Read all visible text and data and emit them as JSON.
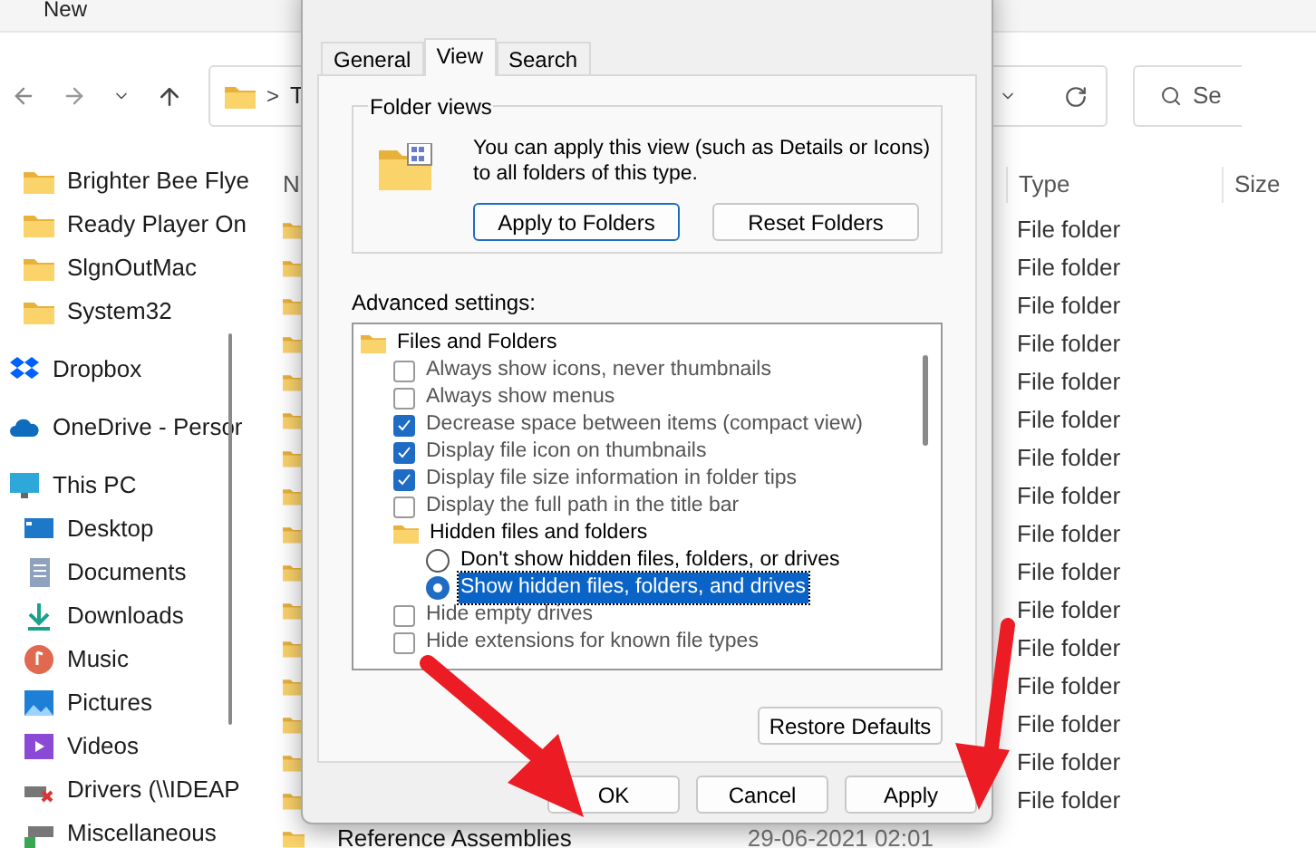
{
  "toolbar": {
    "new_label": "New"
  },
  "address_bar": {
    "separator": ">",
    "path": "T"
  },
  "search": {
    "placeholder": "Se"
  },
  "sidebar": {
    "items": [
      {
        "label": "Brighter Bee Flye",
        "kind": "folder"
      },
      {
        "label": "Ready Player On",
        "kind": "folder"
      },
      {
        "label": "SlgnOutMac",
        "kind": "folder"
      },
      {
        "label": "System32",
        "kind": "folder"
      },
      {
        "label": "Dropbox",
        "kind": "dropbox"
      },
      {
        "label": "OneDrive - Persor",
        "kind": "cloud"
      },
      {
        "label": "This PC",
        "kind": "pc",
        "children": [
          {
            "label": "Desktop",
            "kind": "desktop"
          },
          {
            "label": "Documents",
            "kind": "documents"
          },
          {
            "label": "Downloads",
            "kind": "downloads"
          },
          {
            "label": "Music",
            "kind": "music"
          },
          {
            "label": "Pictures",
            "kind": "pictures"
          },
          {
            "label": "Videos",
            "kind": "videos"
          },
          {
            "label": "Drivers (\\\\IDEAP",
            "kind": "drive"
          },
          {
            "label": "Miscellaneous",
            "kind": "netdrive"
          }
        ]
      }
    ]
  },
  "file_list": {
    "columns": [
      "N",
      "Type",
      "Size"
    ],
    "rows": [
      {
        "type": "File folder"
      },
      {
        "type": "File folder"
      },
      {
        "type": "File folder"
      },
      {
        "type": "File folder"
      },
      {
        "type": "File folder"
      },
      {
        "type": "File folder"
      },
      {
        "type": "File folder"
      },
      {
        "type": "File folder"
      },
      {
        "type": "File folder"
      },
      {
        "type": "File folder"
      },
      {
        "type": "File folder"
      },
      {
        "type": "File folder"
      },
      {
        "type": "File folder"
      },
      {
        "type": "File folder"
      },
      {
        "type": "File folder"
      },
      {
        "type": "File folder"
      },
      {
        "name": "Reference Assemblies",
        "date": "29-06-2021 02:01"
      }
    ]
  },
  "dialog": {
    "tabs": [
      {
        "label": "General",
        "selected": false
      },
      {
        "label": "View",
        "selected": true
      },
      {
        "label": "Search",
        "selected": false
      }
    ],
    "folder_views": {
      "title": "Folder views",
      "description": "You can apply this view (such as Details or Icons) to all folders of this type.",
      "buttons": [
        "Apply to Folders",
        "Reset Folders"
      ]
    },
    "advanced_label": "Advanced settings:",
    "settings": [
      {
        "kind": "folder",
        "label": "Files and Folders",
        "children": [
          {
            "kind": "checkbox",
            "label": "Always show icons, never thumbnails",
            "checked": false
          },
          {
            "kind": "checkbox",
            "label": "Always show menus",
            "checked": false
          },
          {
            "kind": "checkbox",
            "label": "Decrease space between items (compact view)",
            "checked": true
          },
          {
            "kind": "checkbox",
            "label": "Display file icon on thumbnails",
            "checked": true
          },
          {
            "kind": "checkbox",
            "label": "Display file size information in folder tips",
            "checked": true
          },
          {
            "kind": "checkbox",
            "label": "Display the full path in the title bar",
            "checked": false
          },
          {
            "kind": "folder",
            "label": "Hidden files and folders",
            "children": [
              {
                "kind": "radio",
                "label": "Don't show hidden files, folders, or drives",
                "selected": false
              },
              {
                "kind": "radio",
                "label": "Show hidden files, folders, and drives",
                "selected": true
              }
            ]
          },
          {
            "kind": "checkbox",
            "label": "Hide empty drives",
            "checked": false
          },
          {
            "kind": "checkbox",
            "label": "Hide extensions for known file types",
            "checked": false
          }
        ]
      }
    ],
    "restore_button": "Restore Defaults",
    "footer_buttons": [
      "OK",
      "Cancel",
      "Apply"
    ]
  }
}
